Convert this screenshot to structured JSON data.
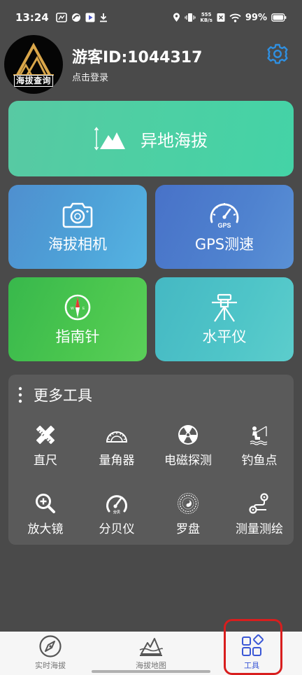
{
  "status_bar": {
    "time": "13:24",
    "net_speed_value": "555",
    "net_speed_unit": "KB/s",
    "battery": "99%",
    "icons": [
      "app-icon",
      "swirl-icon",
      "play-icon",
      "download-icon",
      "location-icon",
      "vibrate-icon",
      "x-icon",
      "wifi-icon",
      "battery-icon"
    ]
  },
  "header": {
    "avatar_caption": "海拔查询",
    "user_name": "游客ID:1044317",
    "login_text": "点击登录",
    "settings_icon": "gear-icon"
  },
  "cards": {
    "main": {
      "label": "异地海拔",
      "icon": "mountain-height-icon"
    },
    "camera": {
      "label": "海拔相机",
      "icon": "camera-icon"
    },
    "gps": {
      "label": "GPS测速",
      "icon": "speedometer-icon",
      "icon_text": "GPS"
    },
    "compass": {
      "label": "指南针",
      "icon": "compass-icon"
    },
    "level": {
      "label": "水平仪",
      "icon": "tripod-level-icon"
    }
  },
  "more_tools": {
    "title": "更多工具",
    "items": [
      {
        "label": "直尺",
        "icon": "ruler-icon"
      },
      {
        "label": "量角器",
        "icon": "protractor-icon"
      },
      {
        "label": "电磁探测",
        "icon": "radiation-icon"
      },
      {
        "label": "钓鱼点",
        "icon": "fishing-icon"
      },
      {
        "label": "放大镜",
        "icon": "magnifier-icon"
      },
      {
        "label": "分贝仪",
        "icon": "decibel-meter-icon"
      },
      {
        "label": "罗盘",
        "icon": "luopan-icon"
      },
      {
        "label": "测量测绘",
        "icon": "route-icon"
      }
    ]
  },
  "bottom_nav": {
    "items": [
      {
        "label": "实时海拔",
        "icon": "compass-nav-icon"
      },
      {
        "label": "海拔地图",
        "icon": "mountain-map-icon"
      },
      {
        "label": "工具",
        "icon": "tools-grid-icon",
        "active": true
      }
    ]
  },
  "colors": {
    "background": "#4a4a4a",
    "panel": "#5a5a5a",
    "accent_blue": "#2f8fe0",
    "active_nav": "#3a57d6",
    "highlight_frame": "#d81e1e"
  }
}
